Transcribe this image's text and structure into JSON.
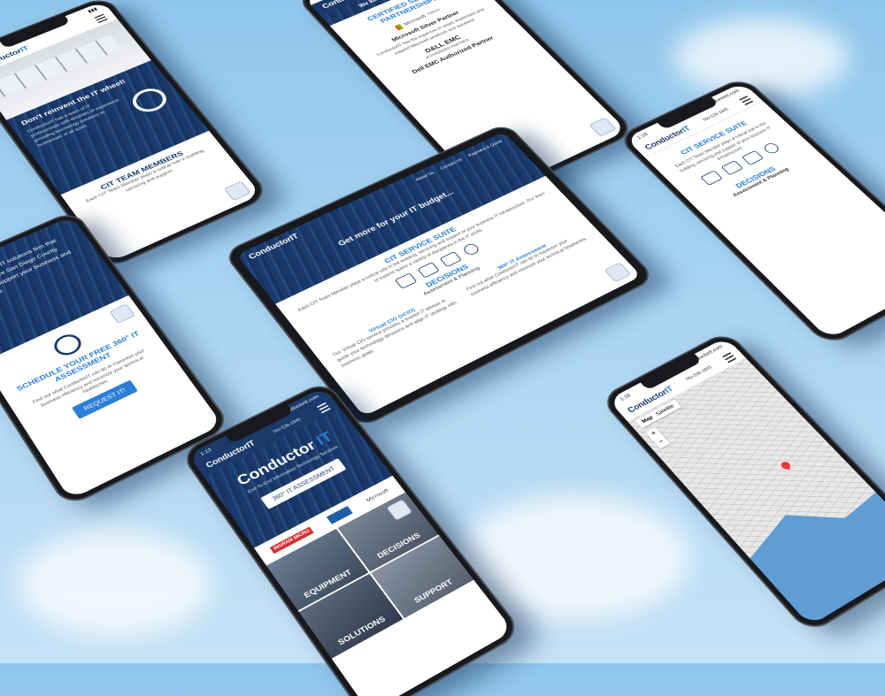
{
  "brand": {
    "logo_main": "Conductor",
    "logo_it": "IT",
    "phone": "760-536-1845",
    "url": "conductorit.com",
    "time": "1:18",
    "time_b": "1:13",
    "colors": {
      "navy": "#1b3a6b",
      "accent": "#2b7fd6",
      "sky": "#a9d4f2"
    }
  },
  "tablet": {
    "nav": [
      "About Us",
      "Contact Us",
      "Payment & Quote"
    ],
    "hero_title": "Get more for your IT budget...",
    "suite_title": "CIT SERVICE SUITE",
    "suite_text": "Each CIT Team Member plays a critical role in the building, servicing and support of your business IT infrastructure. Our team of experts spans a variety of disciplines in the IT world.",
    "decisions_title": "DECISIONS",
    "decisions_sub": "Assessment & Planning",
    "col1_title": "Virtual CIO (vCIO)",
    "col1_text": "Our Virtual CIO service provides a trusted IT advisor to guide your technology decisions and align IT strategy with business goals.",
    "col2_title": "360° IT Assessment",
    "col2_text": "Find out what ConductorIT can do to maximize your business efficiency and minimize your technical headaches."
  },
  "phone_top_left": {
    "heading": "Don't reinvent the IT wheel!",
    "body": "ConductorIT has a team of IT professionals with decades of experience providing technology solutions to businesses of all sizes.",
    "team_title": "CIT TEAM MEMBERS",
    "team_text": "Each CIT Team Member plays a critical role in building, servicing and support."
  },
  "phone_top_center": {
    "banner": "We keep good company",
    "certified_title": "CERTIFIED SERVICE PARTNERSHIPS",
    "ms_logo": "Microsoft",
    "ms_logo_sub": "Partner",
    "ms_label": "Microsoft Silver Partner",
    "ms_text": "ConductorIT has the expertise to resell, implement and support Microsoft products and solutions.",
    "dell_logo": "D&LL EMC",
    "dell_logo_sub": "AUTHORIZED PARTNER",
    "dell_label": "Dell EMC Authorized Partner"
  },
  "phone_right": {
    "suite_title": "CIT SERVICE SUITE",
    "suite_text": "Each CIT Team Member plays a critical role in the building, servicing and support of your business IT infrastructure.",
    "decisions_title": "DECISIONS",
    "decisions_sub": "Assessment & Planning"
  },
  "phone_left": {
    "intro": "ConductorIT is an IT solutions firm that services the entire San Diego County. We're here to support your business and help you grow.",
    "schedule_title": "SCHEDULE YOUR FREE 360° IT ASSESSMENT",
    "schedule_text": "Find out what ConductorIT can do to maximize your business efficiency and minimize your technical headaches.",
    "cta": "REQUEST IT!"
  },
  "phone_bottom_center": {
    "hero_logo_main": "Conductor",
    "hero_logo_it": "IT",
    "tagline": "End-To-End Information Technology Services",
    "cta": "360° IT ASSESSMENT",
    "partner_ingram": "INGRAM MICRO",
    "partner_ms": "Microsoft",
    "tiles": [
      "EQUIPMENT",
      "DECISIONS",
      "SOLUTIONS",
      "SUPPORT"
    ]
  },
  "phone_bottom_right": {
    "map_tab": "Map",
    "sat_tab": "Satellite",
    "zoom_in": "+",
    "zoom_out": "−"
  }
}
